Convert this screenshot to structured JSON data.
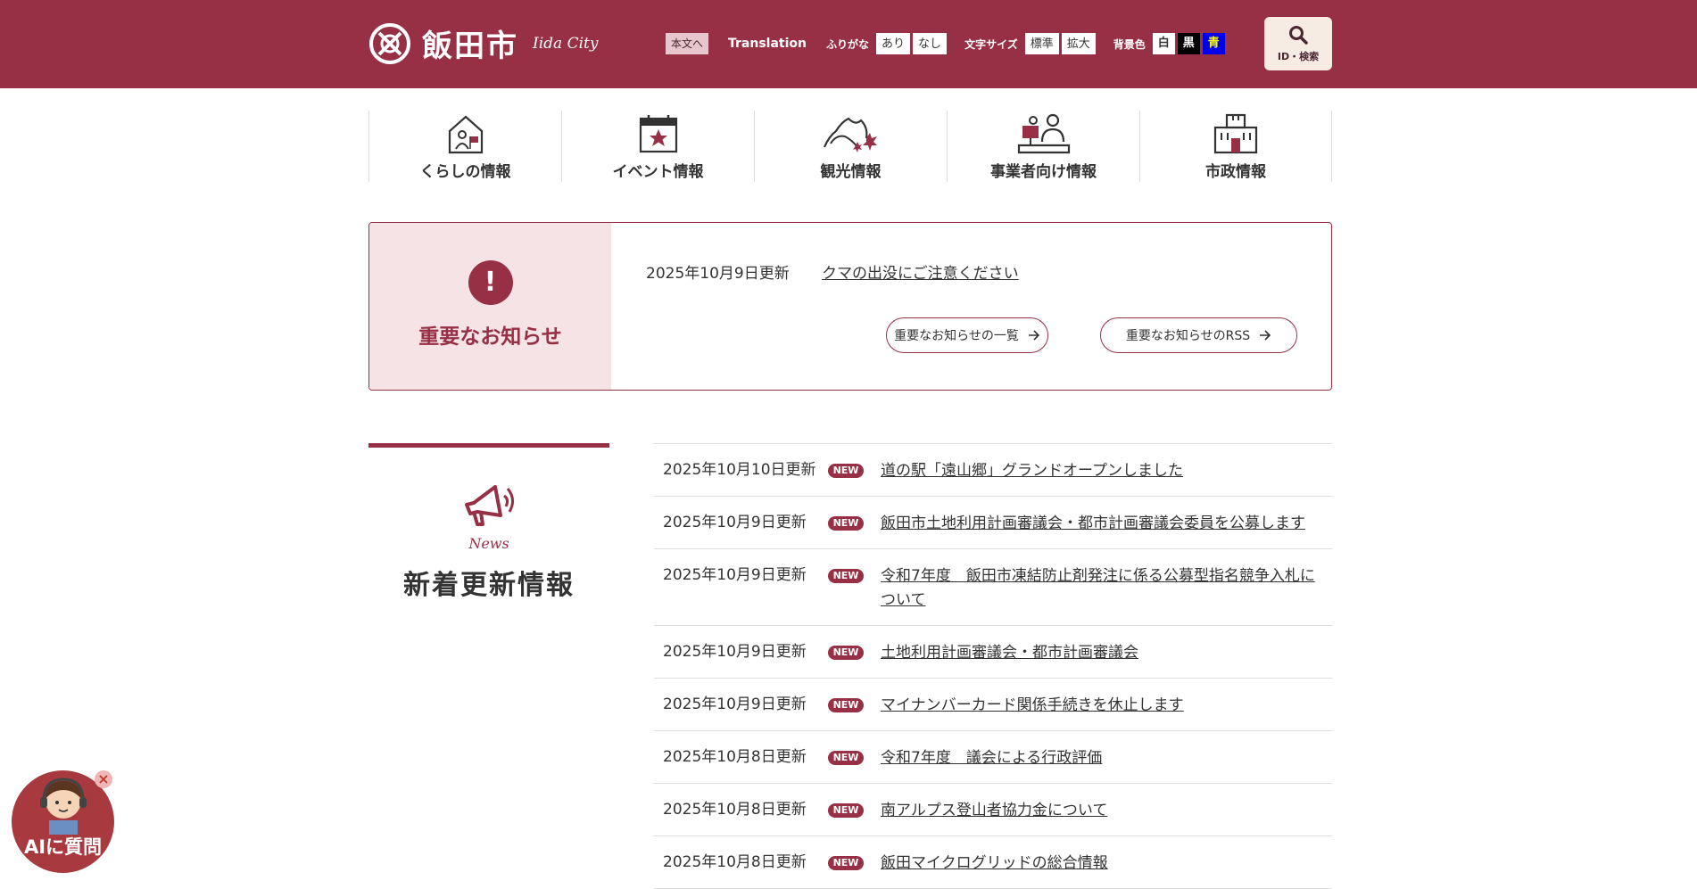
{
  "header": {
    "logo_text": "飯田市",
    "logo_sub": "Iida City",
    "skip_label": "本文へ",
    "translation_label": "Translation",
    "furigana_label": "ふりがな",
    "furigana_on": "あり",
    "furigana_off": "なし",
    "fontsize_label": "文字サイズ",
    "fontsize_normal": "標準",
    "fontsize_large": "拡大",
    "bgcolor_label": "背景色",
    "bg_white": "白",
    "bg_black": "黒",
    "bg_blue": "青",
    "search_label": "ID・検索",
    "brand_color": "#983045"
  },
  "nav": {
    "items": [
      {
        "label": "くらしの情報",
        "icon": "house-icon"
      },
      {
        "label": "イベント情報",
        "icon": "calendar-icon"
      },
      {
        "label": "観光情報",
        "icon": "mountain-icon"
      },
      {
        "label": "事業者向け情報",
        "icon": "business-icon"
      },
      {
        "label": "市政情報",
        "icon": "city-hall-icon"
      }
    ]
  },
  "notice": {
    "title": "重要なお知らせ",
    "date": "2025年10月9日更新",
    "link": "クマの出没にご注意ください",
    "list_button": "重要なお知らせの一覧",
    "rss_button": "重要なお知らせのRSS"
  },
  "news": {
    "label_en": "News",
    "label_jp": "新着更新情報",
    "badge": "NEW",
    "items": [
      {
        "date": "2025年10月10日更新",
        "title": "道の駅「遠山郷」グランドオープンしました"
      },
      {
        "date": "2025年10月9日更新",
        "title": "飯田市土地利用計画審議会・都市計画審議会委員を公募します"
      },
      {
        "date": "2025年10月9日更新",
        "title": "令和7年度　飯田市凍結防止剤発注に係る公募型指名競争入札について"
      },
      {
        "date": "2025年10月9日更新",
        "title": "土地利用計画審議会・都市計画審議会"
      },
      {
        "date": "2025年10月9日更新",
        "title": "マイナンバーカード関係手続きを休止します"
      },
      {
        "date": "2025年10月8日更新",
        "title": "令和7年度　議会による行政評価"
      },
      {
        "date": "2025年10月8日更新",
        "title": "南アルプス登山者協力金について"
      },
      {
        "date": "2025年10月8日更新",
        "title": "飯田マイクログリッドの総合情報"
      }
    ]
  },
  "ai_chat": {
    "label": "AIに質問",
    "close": "×"
  }
}
